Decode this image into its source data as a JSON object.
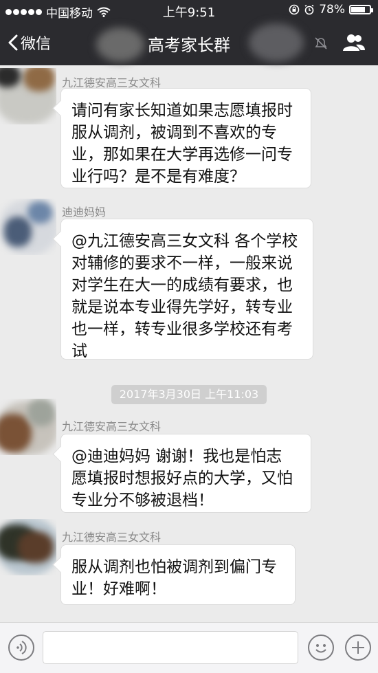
{
  "status_bar": {
    "carrier": "中国移动",
    "time": "上午9:51",
    "battery": "78%",
    "battery_level": 0.78
  },
  "nav": {
    "back_label": "微信",
    "title": "高考家长群"
  },
  "messages": [
    {
      "sender": "九江德安高三女文科",
      "lines": [
        "请问有家长知道如果志愿填报时",
        "服从调剂，被调到不喜欢的专",
        "业，那如果在大学再选修一问专",
        "业行吗？是不是有难度？"
      ]
    },
    {
      "sender": "迪迪妈妈",
      "lines": [
        "@九江德安高三女文科 各个学校",
        "对辅修的要求不一样，一般来说",
        "对学生在大一的成绩有要求，也",
        "就是说本专业得先学好，转专业",
        "也一样，转专业很多学校还有考",
        "试"
      ]
    },
    {
      "sender": "九江德安高三女文科",
      "lines": [
        "@迪迪妈妈  谢谢！我也是怕志",
        "愿填报时想报好点的大学，又怕",
        "专业分不够被退档！"
      ]
    },
    {
      "sender": "九江德安高三女文科",
      "lines": [
        "服从调剂也怕被调剂到偏门专",
        "业！好难啊！"
      ]
    }
  ],
  "timestamp": "2017年3月30日 上午11:03",
  "icons": {
    "voice": "voice-icon",
    "emoji": "emoji-icon",
    "add": "plus-icon",
    "members": "members-icon",
    "back": "chevron-left-icon",
    "wifi": "wifi-icon",
    "lock_rotation": "rotation-lock-icon",
    "alarm": "alarm-icon",
    "mute": "mute-icon"
  },
  "colors": {
    "header": "#2b2b2f",
    "chat_bg": "#ebebeb",
    "bubble": "#ffffff",
    "timestamp_bg": "#cfcfcf"
  }
}
